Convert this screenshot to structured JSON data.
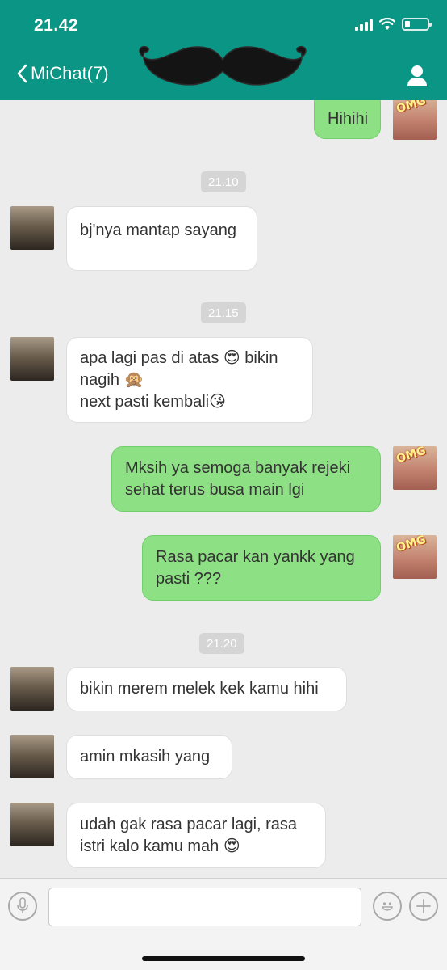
{
  "status_bar": {
    "time": "21.42"
  },
  "header": {
    "back_label": "MiChat(7)"
  },
  "messages": [
    {
      "text": "Hihihi"
    },
    {
      "text": "21.10"
    },
    {
      "text": "bj'nya mantap sayang"
    },
    {
      "text": "21.15"
    },
    {
      "text": "apa lagi pas di atas 😍  bikin\nnagih 🙊\nnext pasti kembali😘"
    },
    {
      "text": "Mksih ya semoga banyak rejeki\nsehat terus busa main lgi"
    },
    {
      "text": "Rasa pacar kan yankk yang\npasti ???"
    },
    {
      "text": "21.20"
    },
    {
      "text": "bikin merem melek kek kamu hihi"
    },
    {
      "text": "amin mkasih yang"
    },
    {
      "text": "udah gak rasa pacar lagi, rasa\nistri kalo kamu mah 😍"
    }
  ],
  "avatar_sticker_text": "OMG",
  "composer": {
    "placeholder": ""
  },
  "colors": {
    "header": "#0a9585",
    "outgoing_bubble": "#8de083",
    "incoming_bubble": "#ffffff",
    "background": "#ececec"
  },
  "icons": [
    "signal-icon",
    "wifi-icon",
    "battery-icon",
    "chevron-left-icon",
    "mustache-sticker",
    "user-icon",
    "microphone-icon",
    "emoji-icon",
    "plus-icon"
  ]
}
